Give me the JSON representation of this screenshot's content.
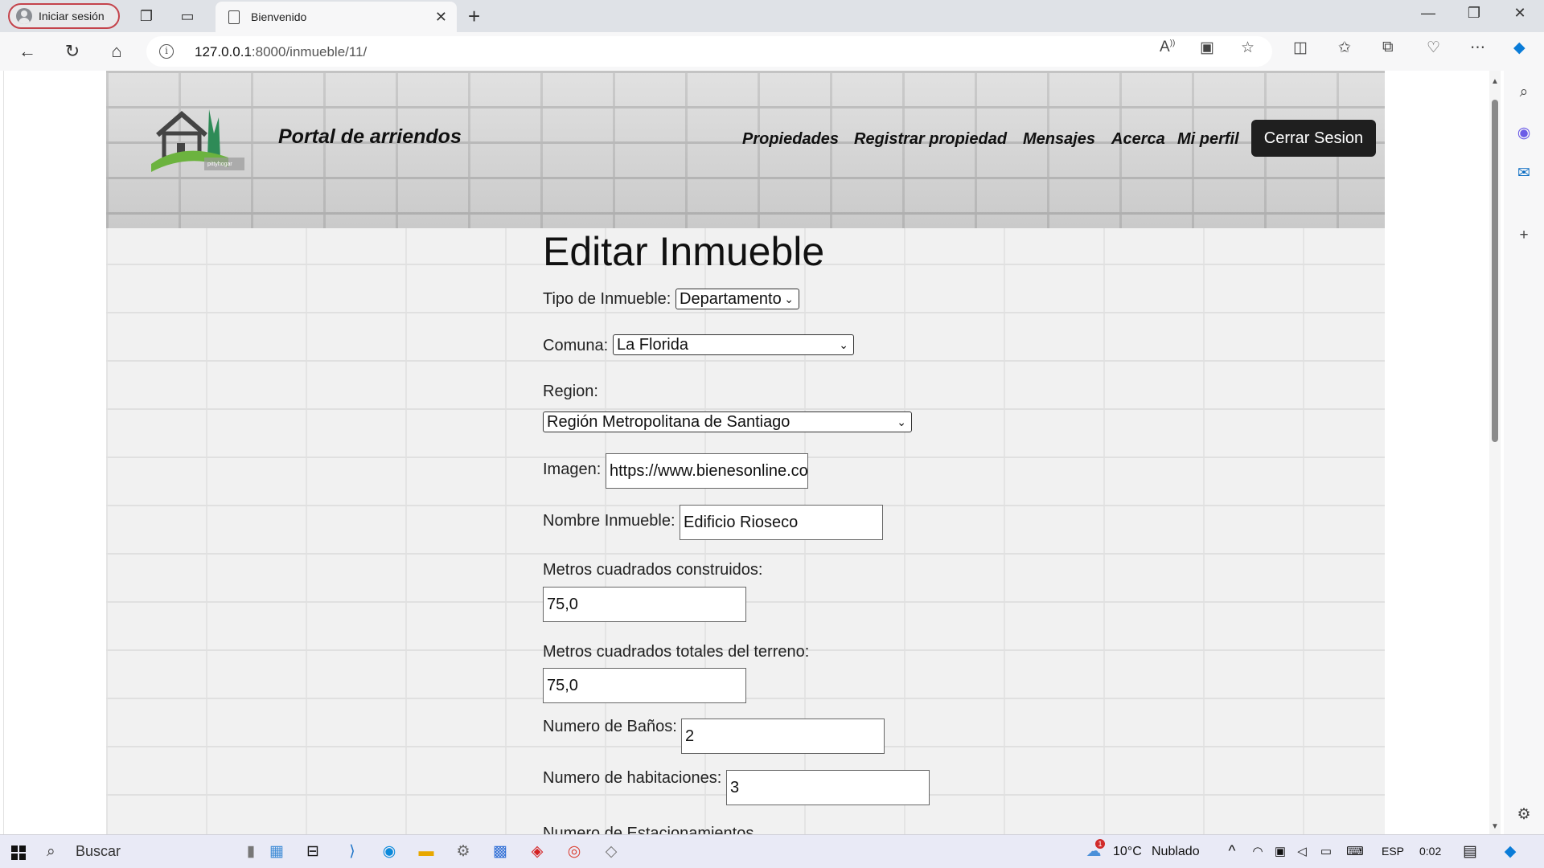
{
  "browser": {
    "profile_label": "Iniciar sesión",
    "tab_title": "Bienvenido",
    "url_host": "127.0.0.1",
    "url_rest": ":8000/inmueble/11/"
  },
  "site": {
    "title": "Portal de arriendos",
    "logo_caption": "pittyhogar",
    "nav": [
      "Propiedades",
      "Registrar propiedad",
      "Mensajes",
      "Acerca",
      "Mi perfil"
    ],
    "logout_label": "Cerrar Sesion"
  },
  "form": {
    "title": "Editar Inmueble",
    "tipo_label": "Tipo de Inmueble:",
    "tipo_value": "Departamento",
    "comuna_label": "Comuna:",
    "comuna_value": "La Florida",
    "region_label": "Region:",
    "region_value": "Región Metropolitana de Santiago",
    "imagen_label": "Imagen:",
    "imagen_value": "https://www.bienesonline.com",
    "nombre_label": "Nombre Inmueble:",
    "nombre_value": "Edificio Rioseco",
    "m2_construidos_label": "Metros cuadrados construidos:",
    "m2_construidos_value": "75,0",
    "m2_totales_label": "Metros cuadrados totales del terreno:",
    "m2_totales_value": "75,0",
    "banos_label": "Numero de Baños:",
    "banos_value": "2",
    "habitaciones_label": "Numero de habitaciones:",
    "habitaciones_value": "3",
    "estacionamientos_label": "Numero de Estacionamientos"
  },
  "taskbar": {
    "search_label": "Buscar",
    "weather_temp": "10°C",
    "weather_desc": "Nublado",
    "language": "ESP",
    "time": "0:02",
    "weather_badge": "1"
  },
  "colors": {
    "profile_border": "#c4434b",
    "logout_bg": "#1f1f1f",
    "edge_accent": "#0a7cd8"
  }
}
